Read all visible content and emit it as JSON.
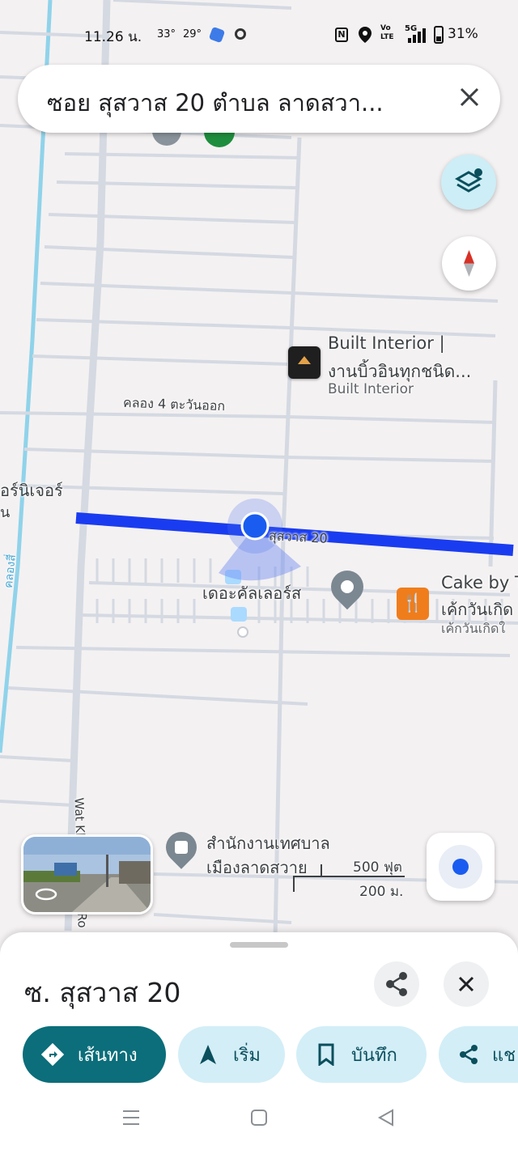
{
  "status_bar": {
    "time": "11.26 น.",
    "temp_high": "33°",
    "temp_low": "29°",
    "network_label": "5G",
    "volte_label": "Vo LTE",
    "battery": "31%"
  },
  "search": {
    "query": "ซอย สุสวาส 20 ตำบล ลาดสวา..."
  },
  "map": {
    "poi_built_interior_name": "Built Interior |",
    "poi_built_interior_line2": "งานบิ้วอินทุกชนิด...",
    "poi_built_interior_sub": "Built Interior",
    "road_klong4": "คลอง 4 ตะวันออก",
    "road_susawat20": "สุสวาส 20",
    "poi_the_colors": "เดอะคัลเลอร์ส",
    "poi_cake_name": "Cake by T",
    "poi_cake_line2": "เค้กวันเกิด",
    "poi_cake_sub": "เค้กวันเกิดใ",
    "left_label": "อร์นิเจอร์",
    "left_label2": "น",
    "canal_label": "คลองสี่",
    "road_wat": "Wat Kla",
    "road_rd": "Ro",
    "poi_office_line1": "สำนักงานเทศบาล",
    "poi_office_line2": "เมืองลาดสวาย",
    "scale_ft": "500 ฟุต",
    "scale_m": "200 ม.",
    "accent_route_color": "#1a3cf0",
    "location_dot_color": "#1a5cf0"
  },
  "sheet": {
    "place_name": "ซ. สุสวาส 20",
    "chips": {
      "directions": "เส้นทาง",
      "start": "เริ่ม",
      "save": "บันทึก",
      "share": "แช"
    }
  }
}
